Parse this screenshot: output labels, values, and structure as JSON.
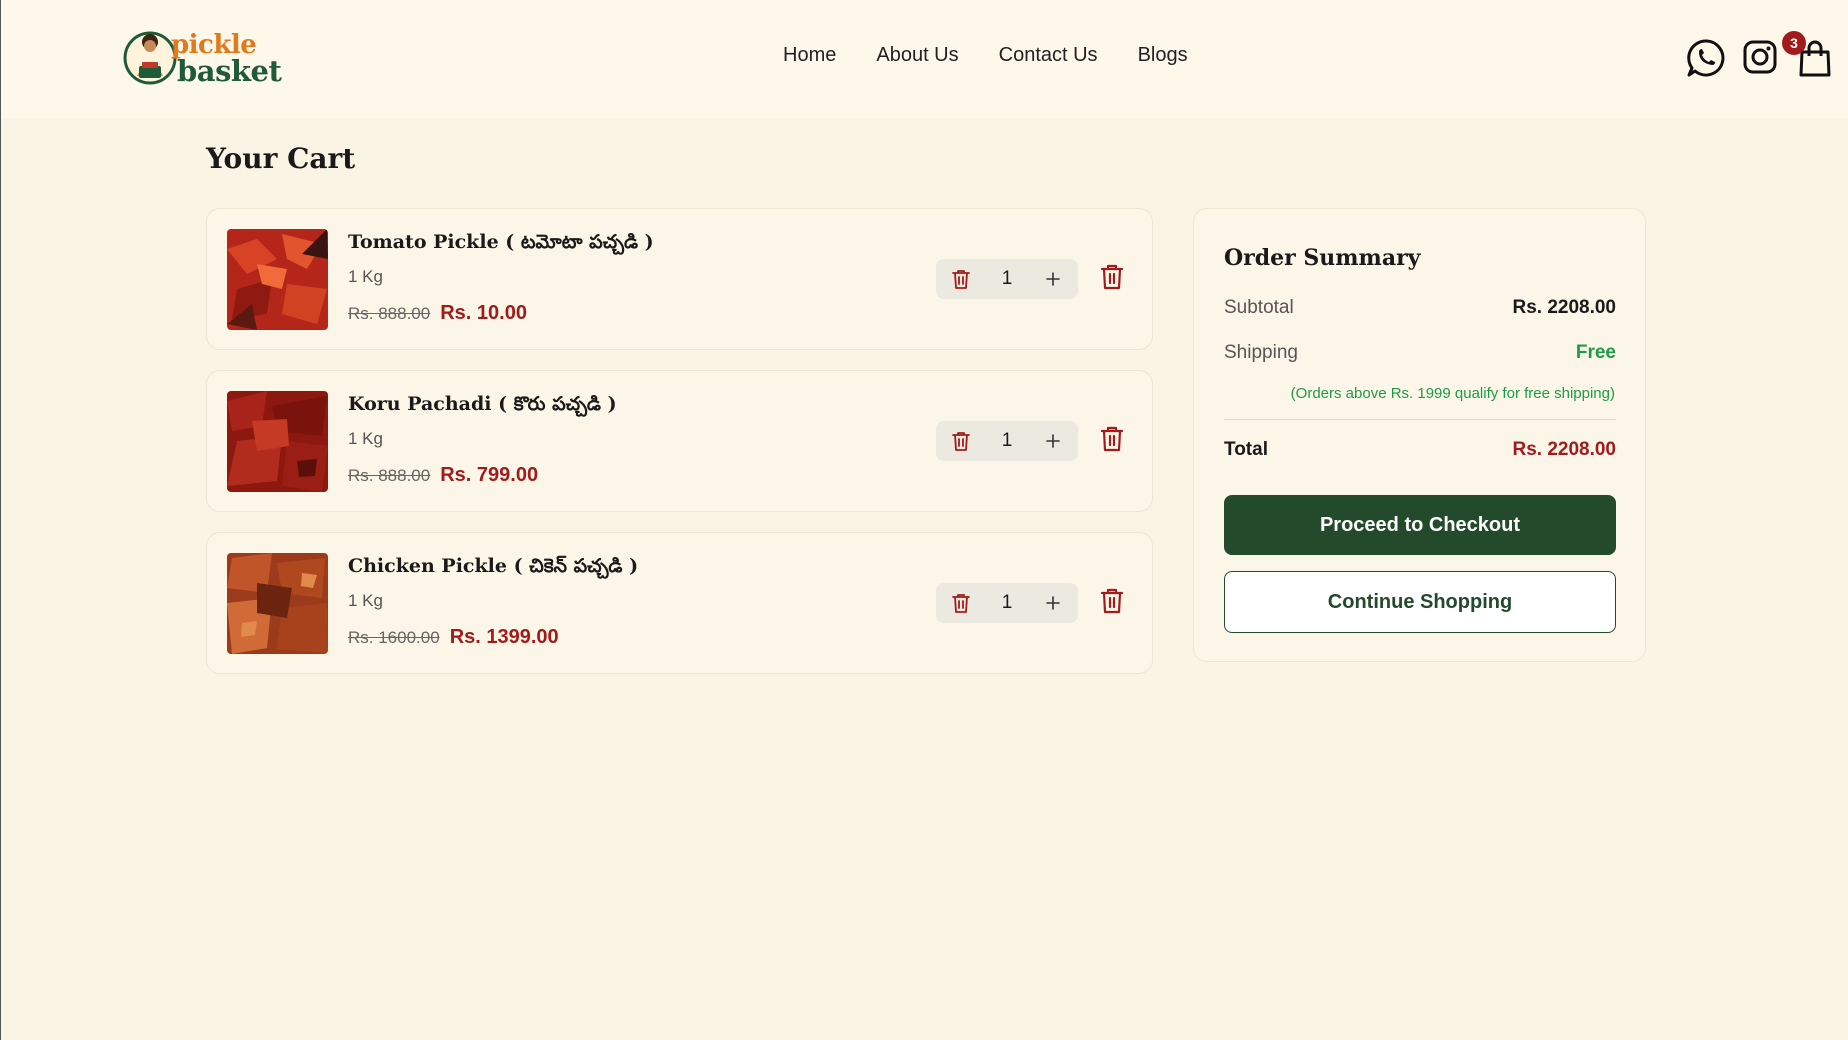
{
  "brand": {
    "logo_line1": "pickle",
    "logo_line2": "basket"
  },
  "nav": {
    "items": [
      {
        "label": "Home"
      },
      {
        "label": "About Us"
      },
      {
        "label": "Contact Us"
      },
      {
        "label": "Blogs"
      }
    ]
  },
  "header_icons": {
    "whatsapp": "whatsapp-icon",
    "instagram": "instagram-icon",
    "bag": "shopping-bag-icon",
    "cart_count": "3"
  },
  "page": {
    "title": "Your Cart"
  },
  "cart": {
    "items": [
      {
        "name": "Tomato Pickle ( టమోటా పచ్చడి )",
        "weight": "1 Kg",
        "old_price": "Rs. 888.00",
        "price": "Rs. 10.00",
        "qty": "1"
      },
      {
        "name": "Koru Pachadi ( కొరు పచ్చడి )",
        "weight": "1 Kg",
        "old_price": "Rs. 888.00",
        "price": "Rs. 799.00",
        "qty": "1"
      },
      {
        "name": "Chicken Pickle ( చికెన్ పచ్చడి )",
        "weight": "1 Kg",
        "old_price": "Rs. 1600.00",
        "price": "Rs. 1399.00",
        "qty": "1"
      }
    ]
  },
  "summary": {
    "title": "Order Summary",
    "subtotal_label": "Subtotal",
    "subtotal_value": "Rs. 2208.00",
    "shipping_label": "Shipping",
    "shipping_value": "Free",
    "shipping_note": "(Orders above Rs. 1999 qualify for free shipping)",
    "total_label": "Total",
    "total_value": "Rs. 2208.00",
    "checkout_label": "Proceed to Checkout",
    "continue_label": "Continue Shopping"
  },
  "colors": {
    "accent": "#a01c1c",
    "brand_green": "#244a2c",
    "free_green": "#1f9a4a",
    "background": "#faf4e4"
  }
}
